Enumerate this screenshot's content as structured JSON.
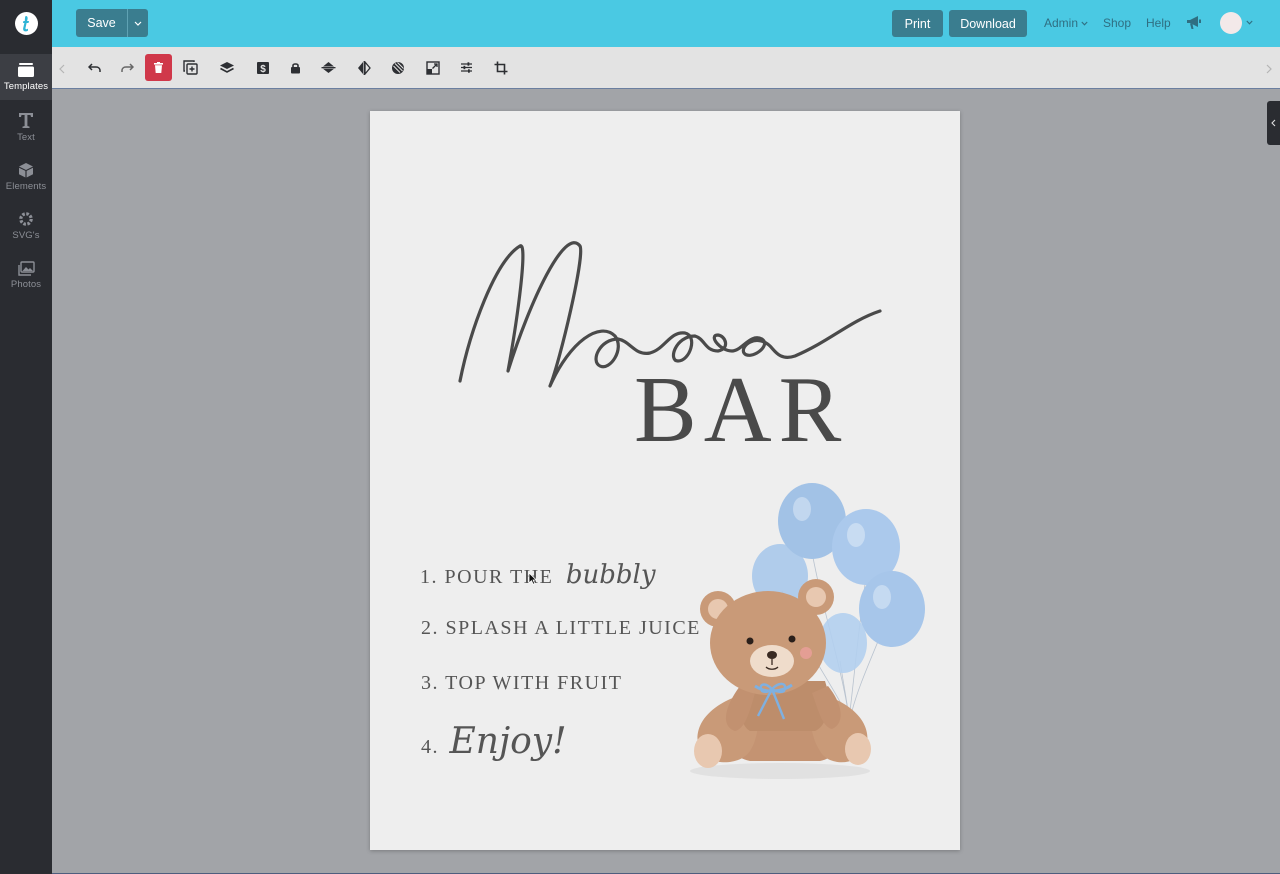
{
  "sidebar": {
    "items": [
      {
        "label": "Templates",
        "icon": "templates-icon"
      },
      {
        "label": "Text",
        "icon": "text-icon"
      },
      {
        "label": "Elements",
        "icon": "elements-icon"
      },
      {
        "label": "SVG's",
        "icon": "svg-icon"
      },
      {
        "label": "Photos",
        "icon": "photos-icon"
      }
    ]
  },
  "topbar": {
    "save_label": "Save",
    "print_label": "Print",
    "download_label": "Download",
    "admin_label": "Admin",
    "shop_label": "Shop",
    "help_label": "Help"
  },
  "design": {
    "title_script": "Momosa",
    "title_main": "BAR",
    "steps": [
      {
        "num": "1.",
        "text": "POUR THE",
        "script": "bubbly"
      },
      {
        "num": "2.",
        "text": "SPLASH A LITTLE JUICE"
      },
      {
        "num": "3.",
        "text": "TOP WITH FRUIT"
      },
      {
        "num": "4.",
        "script": "Enjoy!"
      }
    ]
  },
  "colors": {
    "topbar": "#4ac9e3",
    "button": "#3a7d8f",
    "sidebar": "#2a2c31",
    "delete": "#d0384a",
    "balloon": "#a9c8ea",
    "bear": "#c99a78"
  }
}
